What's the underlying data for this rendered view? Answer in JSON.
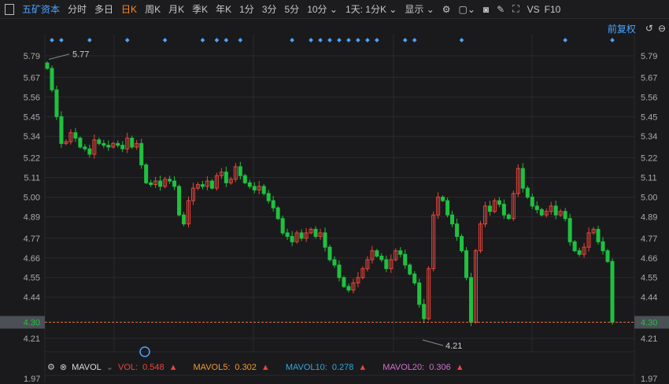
{
  "toolbar": {
    "stock_name": "五矿资本",
    "items": [
      "分时",
      "多日",
      "日K",
      "周K",
      "月K",
      "季K",
      "年K",
      "1分",
      "3分",
      "5分",
      "10分 ⌄",
      "1天: 1分K ⌄"
    ],
    "active_index": 2,
    "display": "显示 ⌄",
    "vs": "VS",
    "f10": "F10"
  },
  "subbar": {
    "adjust": "前复权"
  },
  "indicator": {
    "name": "MAVOL",
    "vol_label": "VOL:",
    "vol": "0.548",
    "mavol5_label": "MAVOL5:",
    "mavol5": "0.302",
    "mavol10_label": "MAVOL10:",
    "mavol10": "0.278",
    "mavol20_label": "MAVOL20:",
    "mavol20": "0.306",
    "up_mark": "▲",
    "bottom_tick": "1.97"
  },
  "colors": {
    "up": "#e8453c",
    "down": "#1fc140",
    "grid": "#2a2a2c",
    "current": "#e07040",
    "accent": "#4da3ff"
  },
  "chart_data": {
    "type": "candlestick",
    "y_ticks": [
      "5.79",
      "5.67",
      "5.56",
      "5.45",
      "5.34",
      "5.22",
      "5.11",
      "5.00",
      "4.89",
      "4.77",
      "4.66",
      "4.55",
      "4.44",
      "4.21"
    ],
    "ylim": [
      4.21,
      5.79
    ],
    "current_price": "4.30",
    "max_label": "5.77",
    "min_label": "4.21",
    "closes": [
      5.72,
      5.6,
      5.45,
      5.3,
      5.31,
      5.36,
      5.33,
      5.28,
      5.27,
      5.24,
      5.32,
      5.3,
      5.29,
      5.28,
      5.3,
      5.29,
      5.27,
      5.33,
      5.28,
      5.3,
      5.18,
      5.08,
      5.07,
      5.09,
      5.06,
      5.1,
      5.09,
      5.06,
      4.9,
      4.85,
      4.98,
      5.05,
      5.07,
      5.06,
      5.09,
      5.05,
      5.12,
      5.14,
      5.08,
      5.1,
      5.17,
      5.12,
      5.08,
      5.06,
      5.04,
      5.06,
      5.02,
      4.98,
      4.94,
      4.88,
      4.8,
      4.78,
      4.75,
      4.8,
      4.77,
      4.8,
      4.82,
      4.78,
      4.8,
      4.72,
      4.65,
      4.62,
      4.55,
      4.5,
      4.48,
      4.52,
      4.55,
      4.6,
      4.65,
      4.7,
      4.67,
      4.65,
      4.6,
      4.65,
      4.7,
      4.68,
      4.62,
      4.57,
      4.52,
      4.4,
      4.32,
      4.6,
      4.9,
      5.0,
      4.98,
      4.9,
      4.85,
      4.78,
      4.7,
      4.55,
      4.3,
      4.7,
      4.85,
      4.95,
      4.92,
      4.98,
      4.96,
      4.9,
      4.88,
      5.02,
      5.16,
      5.05,
      5.0,
      4.95,
      4.93,
      4.9,
      4.92,
      4.95,
      4.9,
      4.92,
      4.88,
      4.75,
      4.7,
      4.68,
      4.72,
      4.8,
      4.82,
      4.75,
      4.7,
      4.64,
      4.3
    ],
    "event_marks_at": [
      1,
      3,
      9,
      17,
      25,
      33,
      36,
      38,
      41,
      52,
      56,
      58,
      60,
      62,
      64,
      66,
      68,
      70,
      76,
      78,
      88,
      110,
      120
    ]
  }
}
